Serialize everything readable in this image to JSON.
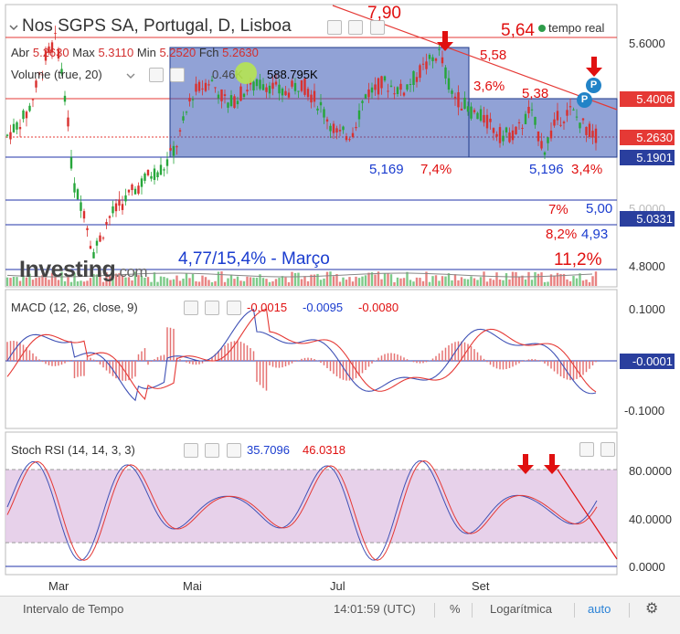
{
  "header": {
    "symbol_title": "Nos SGPS SA, Portugal, D, Lisboa",
    "realtime_label": "tempo real",
    "ohlc": {
      "open_label": "Abr",
      "open_value": "5.2630",
      "max_label": "Max",
      "max_value": "5.3110",
      "min_label": "Min",
      "min_value": "5.2520",
      "close_label": "Fch",
      "close_value": "5.2630"
    },
    "volume_label": "Volume (true, 20)",
    "volume_value1": "0.46K",
    "volume_value2": "588.795K"
  },
  "price_scale": {
    "ticks": [
      "5.6000",
      "5.4006",
      "5.2630",
      "5.1901",
      "5.0331",
      "4.8000"
    ],
    "tag_5_40": "5.4006",
    "tag_5_26": "5.2630",
    "tag_5_19": "5.1901",
    "tag_5_03": "5.0331",
    "partial_tick": "5.0000"
  },
  "annotations": {
    "a790": "7,90",
    "a564": "5,64",
    "a558": "5,58",
    "a36": "3,6%",
    "a538": "5,38",
    "a5169": "5,169",
    "a74": "7,4%",
    "a5196": "5,196",
    "a34": "3,4%",
    "a7": "7%",
    "a500": "5,00",
    "a82": "8,2%",
    "a493": "4,93",
    "a477": "4,77/15,4%  - Março",
    "a112": "11,2%",
    "p_marker": "P",
    "brand": "Investing",
    "brand_suffix": ".com"
  },
  "macd": {
    "title": "MACD (12, 26, close, 9)",
    "v1": "-0.0015",
    "v2": "-0.0095",
    "v3": "-0.0080",
    "ticks": [
      "0.1000",
      "-0.0001",
      "-0.1000"
    ]
  },
  "stoch": {
    "title": "Stoch RSI (14, 14, 3, 3)",
    "v1": "35.7096",
    "v2": "46.0318",
    "ticks": [
      "80.0000",
      "40.0000",
      "0.0000"
    ]
  },
  "time_axis": [
    "Mar",
    "Mai",
    "Jul",
    "Set"
  ],
  "bottom_bar": {
    "interval": "Intervalo de Tempo",
    "time": "14:01:59 (UTC)",
    "percent": "%",
    "log": "Logarítmica",
    "auto": "auto"
  },
  "colors": {
    "up": "#26a63a",
    "down": "#d9312f",
    "box_fill": "#3655b5",
    "trend_red": "#e53935",
    "level_blue": "#2233aa",
    "stoch_fill": "#e3c9e6"
  }
}
